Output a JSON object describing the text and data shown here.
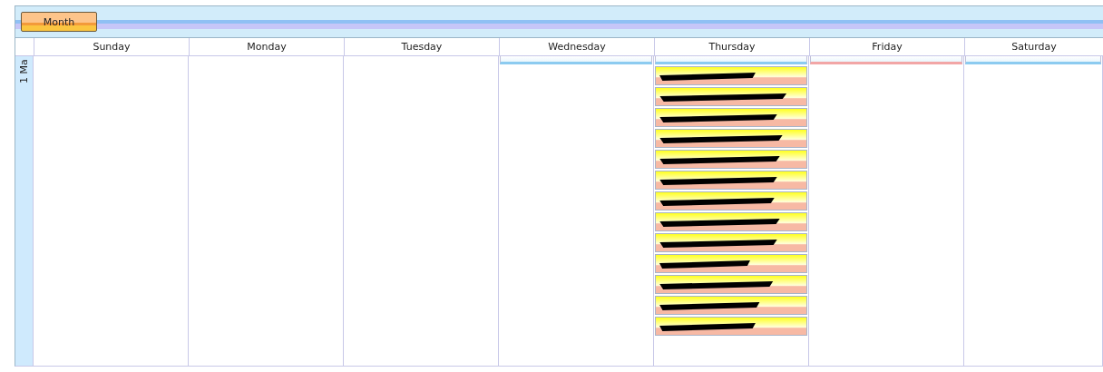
{
  "toolbar": {
    "view_buttons": [
      {
        "label": "Month",
        "selected": true
      }
    ]
  },
  "days": [
    "Sunday",
    "Monday",
    "Tuesday",
    "Wednesday",
    "Thursday",
    "Friday",
    "Saturday"
  ],
  "weeks": [
    {
      "label": "1 Ma",
      "cells": [
        {},
        {},
        {},
        {
          "events": [
            {
              "color": "#8ccbf0",
              "redacted": false
            }
          ]
        },
        {
          "events": [
            {
              "color": "#8ccbf0",
              "redacted": false
            },
            {
              "color": "#f7b9a4",
              "redacted": true
            },
            {
              "color": "#f7b9a4",
              "redacted": true
            },
            {
              "color": "#f7b9a4",
              "redacted": true
            },
            {
              "color": "#f7b9a4",
              "redacted": true
            },
            {
              "color": "#f7b9a4",
              "redacted": true
            },
            {
              "color": "#f7b9a4",
              "redacted": true
            },
            {
              "color": "#f7b9a4",
              "redacted": true
            },
            {
              "color": "#f7b9a4",
              "redacted": true
            },
            {
              "color": "#f7b9a4",
              "redacted": true
            },
            {
              "color": "#f7b9a4",
              "redacted": true
            },
            {
              "color": "#f7b9a4",
              "redacted": true
            },
            {
              "color": "#f7b9a4",
              "redacted": true
            },
            {
              "color": "#f7b9a4",
              "redacted": true
            }
          ]
        },
        {
          "events": [
            {
              "color": "#f2a6a6",
              "redacted": false
            }
          ]
        },
        {
          "events": [
            {
              "color": "#8ccbf0",
              "redacted": false
            }
          ]
        }
      ]
    }
  ]
}
